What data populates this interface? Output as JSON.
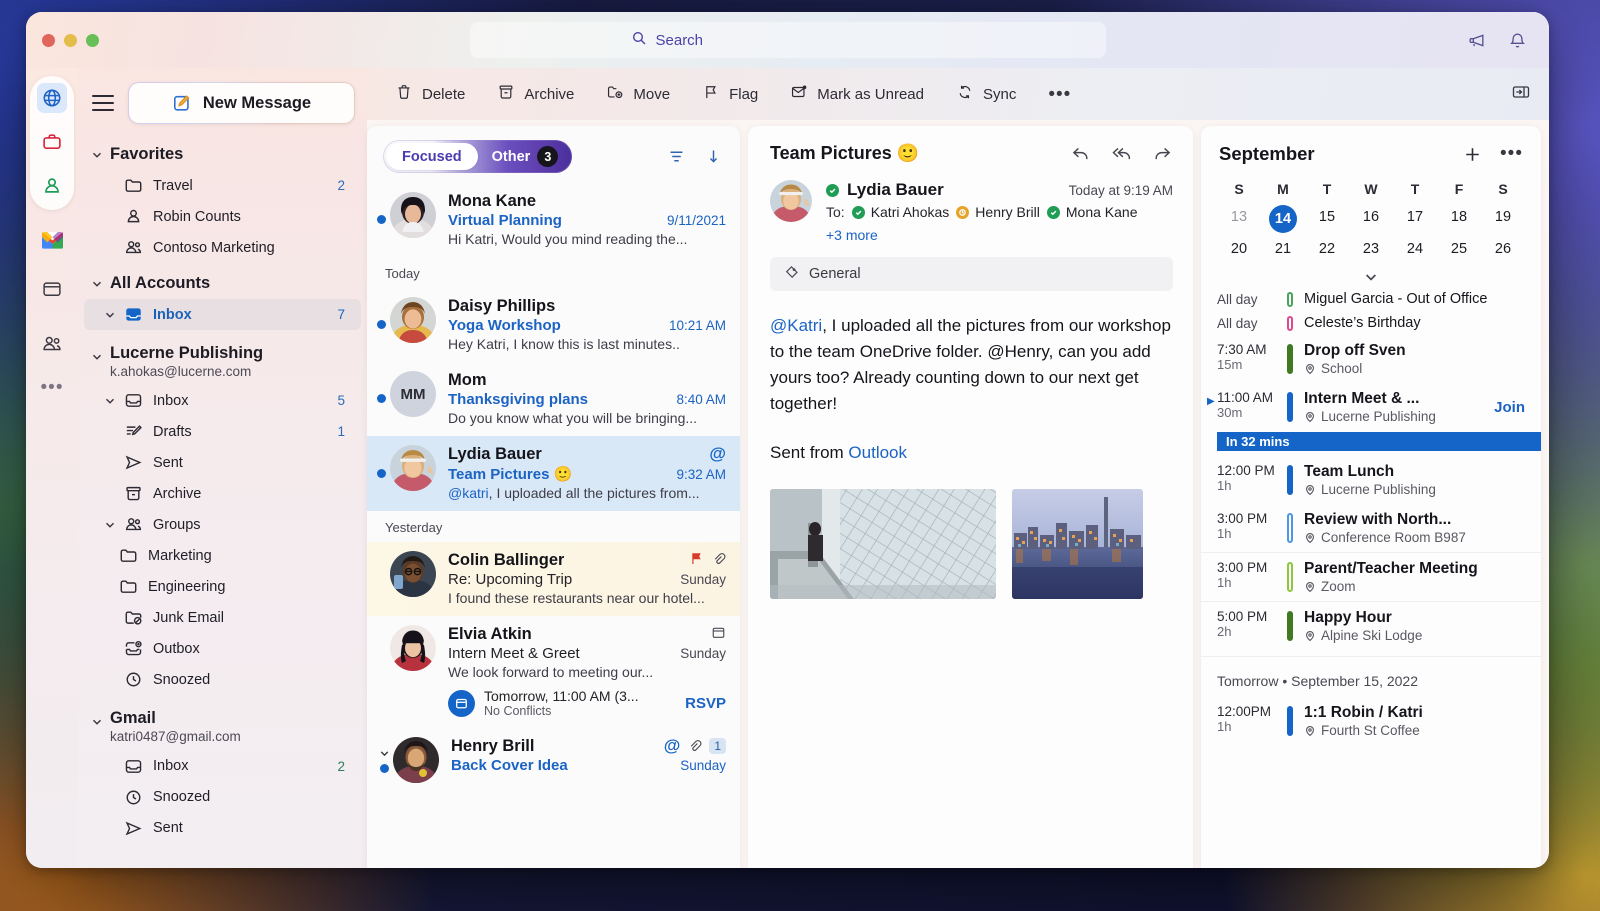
{
  "titlebar": {
    "search_placeholder": "Search",
    "icons": [
      "megaphone-icon",
      "bell-icon"
    ]
  },
  "rail": {
    "items": [
      {
        "name": "globe-icon",
        "selected": true
      },
      {
        "name": "briefcase-icon",
        "selected": false
      },
      {
        "name": "person-icon",
        "selected": false
      },
      {
        "name": "gmail-icon",
        "selected": false
      },
      {
        "name": "calendar-icon",
        "selected": false
      },
      {
        "name": "people-icon",
        "selected": false
      },
      {
        "name": "more-icon",
        "label": "•••"
      }
    ]
  },
  "sidebar": {
    "new_message": "New Message",
    "favorites": {
      "title": "Favorites",
      "items": [
        {
          "label": "Travel",
          "icon": "folder-icon",
          "count": "2"
        },
        {
          "label": "Robin Counts",
          "icon": "person-icon",
          "count": ""
        },
        {
          "label": "Contoso Marketing",
          "icon": "people-icon",
          "count": ""
        }
      ]
    },
    "all_accounts": {
      "title": "All Accounts",
      "items": [
        {
          "label": "Inbox",
          "icon": "inbox-icon",
          "count": "7",
          "active": true
        }
      ]
    },
    "accounts": [
      {
        "name": "Lucerne Publishing",
        "email": "k.ahokas@lucerne.com",
        "items": [
          {
            "label": "Inbox",
            "icon": "inbox-icon",
            "count": "5",
            "twisty": true,
            "indent": 1
          },
          {
            "label": "Drafts",
            "icon": "drafts-icon",
            "count": "1",
            "indent": 1
          },
          {
            "label": "Sent",
            "icon": "sent-icon",
            "count": "",
            "indent": 1
          },
          {
            "label": "Archive",
            "icon": "archive-icon",
            "count": "",
            "indent": 1
          },
          {
            "label": "Groups",
            "icon": "people-icon",
            "count": "",
            "twisty": true,
            "indent": 1
          },
          {
            "label": "Marketing",
            "icon": "folder-icon",
            "count": "",
            "indent": 2
          },
          {
            "label": "Engineering",
            "icon": "folder-icon",
            "count": "",
            "indent": 2
          },
          {
            "label": "Junk Email",
            "icon": "junk-icon",
            "count": "",
            "indent": 1
          },
          {
            "label": "Outbox",
            "icon": "outbox-icon",
            "count": "",
            "indent": 1
          },
          {
            "label": "Snoozed",
            "icon": "clock-icon",
            "count": "",
            "indent": 1
          }
        ]
      },
      {
        "name": "Gmail",
        "email": "katri0487@gmail.com",
        "items": [
          {
            "label": "Inbox",
            "icon": "inbox-icon",
            "count": "2",
            "indent": 1
          },
          {
            "label": "Snoozed",
            "icon": "clock-icon",
            "count": "",
            "indent": 1
          },
          {
            "label": "Sent",
            "icon": "sent-icon",
            "count": "",
            "indent": 1
          }
        ]
      }
    ]
  },
  "toolbar": {
    "items": [
      {
        "label": "Delete",
        "icon": "trash-icon"
      },
      {
        "label": "Archive",
        "icon": "archive-icon"
      },
      {
        "label": "Move",
        "icon": "move-icon"
      },
      {
        "label": "Flag",
        "icon": "flag-icon"
      },
      {
        "label": "Mark as Unread",
        "icon": "mail-unread-icon"
      },
      {
        "label": "Sync",
        "icon": "sync-icon"
      }
    ],
    "overflow": "•••",
    "pane_toggle": "pane-toggle-icon"
  },
  "message_list": {
    "pivot": {
      "focused": "Focused",
      "other": "Other",
      "other_count": "3"
    },
    "actions": [
      "filter-icon",
      "sort-icon"
    ],
    "groups": [
      {
        "label": "",
        "messages": [
          {
            "sender": "Mona Kane",
            "subject": "Virtual Planning",
            "preview": "Hi Katri, Would you mind reading the...",
            "time": "9/11/2021",
            "unread": true,
            "avatar_type": "photo",
            "avatar_style": "mona"
          }
        ]
      },
      {
        "label": "Today",
        "messages": [
          {
            "sender": "Daisy Phillips",
            "subject": "Yoga Workshop",
            "preview": "Hey Katri, I know this is last minutes..",
            "time": "10:21 AM",
            "unread": true,
            "avatar_type": "photo",
            "avatar_style": "daisy"
          },
          {
            "sender": "Mom",
            "subject": "Thanksgiving plans",
            "preview": "Do you know what you will be bringing...",
            "time": "8:40 AM",
            "unread": true,
            "avatar_type": "initials",
            "initials": "MM"
          },
          {
            "sender": "Lydia Bauer",
            "subject": "Team Pictures 🙂",
            "preview_mention": "@katri",
            "preview": ", I uploaded all the pictures from...",
            "time": "9:32 AM",
            "unread": true,
            "selected": true,
            "mention_flag": "@",
            "avatar_type": "photo",
            "avatar_style": "lydia"
          }
        ]
      },
      {
        "label": "Yesterday",
        "messages": [
          {
            "sender": "Colin Ballinger",
            "subject": "Re: Upcoming Trip",
            "subject_plain": true,
            "preview": "I found these restaurants near our hotel...",
            "time": "Sunday",
            "time_grey": true,
            "flagged": true,
            "has_flag_icon": true,
            "has_attach": true,
            "avatar_type": "photo",
            "avatar_style": "colin"
          },
          {
            "sender": "Elvia Atkin",
            "subject": "Intern Meet & Greet",
            "subject_plain": true,
            "preview": "We look forward to meeting our...",
            "time": "Sunday",
            "time_grey": true,
            "has_calendar_icon": true,
            "avatar_type": "photo",
            "avatar_style": "elvia",
            "rsvp": {
              "line1": "Tomorrow, 11:00 AM (3...",
              "line2": "No Conflicts",
              "button": "RSVP"
            }
          },
          {
            "sender": "Henry Brill",
            "subject": "Back Cover Idea",
            "time": "Sunday",
            "unread": true,
            "twisty": true,
            "mention_flag": "@",
            "has_attach": true,
            "count_badge": "1",
            "avatar_type": "photo",
            "avatar_style": "henry"
          }
        ]
      }
    ]
  },
  "reading_pane": {
    "title": "Team Pictures 🙂",
    "actions": [
      "reply-icon",
      "reply-all-icon",
      "forward-icon"
    ],
    "sender": "Lydia Bauer",
    "sender_presence": "available",
    "timestamp": "Today at 9:19 AM",
    "to_label": "To:",
    "recipients": [
      {
        "name": "Katri Ahokas",
        "presence": "available"
      },
      {
        "name": "Henry Brill",
        "presence": "away"
      },
      {
        "name": "Mona Kane",
        "presence": "available"
      }
    ],
    "more_recipients": "+3 more",
    "tag": "General",
    "body_mention": "@Katri",
    "body_text": ", I uploaded all the pictures from our workshop to the team OneDrive folder. @Henry, can you add yours too? Already counting down to our next get together!",
    "sent_from_label": "Sent from ",
    "sent_from_link": "Outlook",
    "attachments": [
      "glass-architecture-photo",
      "city-skyline-photo"
    ]
  },
  "calendar": {
    "month": "September",
    "add_icon": "plus-icon",
    "more_icon": "•••",
    "dow": [
      "S",
      "M",
      "T",
      "W",
      "T",
      "F",
      "S"
    ],
    "weeks": [
      [
        {
          "d": "13",
          "dim": true
        },
        {
          "d": "14",
          "selected": true
        },
        {
          "d": "15"
        },
        {
          "d": "16"
        },
        {
          "d": "17"
        },
        {
          "d": "18"
        },
        {
          "d": "19"
        }
      ],
      [
        {
          "d": "20"
        },
        {
          "d": "21"
        },
        {
          "d": "22"
        },
        {
          "d": "23"
        },
        {
          "d": "24"
        },
        {
          "d": "25"
        },
        {
          "d": "26"
        }
      ]
    ],
    "events": [
      {
        "time": "All day",
        "dur": "",
        "title": "Miguel Garcia - Out of Office",
        "loc": "",
        "color": "#4aa35a",
        "filled": false,
        "allday": true,
        "light": true
      },
      {
        "time": "All day",
        "dur": "",
        "title": "Celeste’s Birthday",
        "loc": "",
        "color": "#e0498f",
        "filled": false,
        "allday": true,
        "light": true
      },
      {
        "time": "7:30 AM",
        "dur": "15m",
        "title": "Drop off Sven",
        "loc": "School",
        "color": "#3f7a23",
        "filled": true
      },
      {
        "time": "11:00 AM",
        "dur": "30m",
        "title": "Intern Meet & ...",
        "loc": "Lucerne Publishing",
        "color": "#1565c9",
        "filled": true,
        "join": "Join",
        "caret": true
      },
      {
        "time": "12:00 PM",
        "dur": "1h",
        "title": "Team Lunch",
        "loc": "Lucerne Publishing",
        "color": "#1565c9",
        "filled": true
      },
      {
        "time": "3:00 PM",
        "dur": "1h",
        "title": "Review with North...",
        "loc": "Conference Room B987",
        "color": "#4f95e8",
        "filled": false
      },
      {
        "time": "3:00 PM",
        "dur": "1h",
        "title": "Parent/Teacher Meeting",
        "loc": "Zoom",
        "color": "#8ec63f",
        "filled": false
      },
      {
        "time": "5:00 PM",
        "dur": "2h",
        "title": "Happy Hour",
        "loc": "Alpine Ski Lodge",
        "color": "#3f7a23",
        "filled": true
      }
    ],
    "now_chip": "In 32 mins",
    "tomorrow_label": "Tomorrow • September 15, 2022",
    "tomorrow_events": [
      {
        "time": "12:00PM",
        "dur": "1h",
        "title": "1:1 Robin / Katri",
        "loc": "Fourth St Coffee",
        "color": "#1565c9",
        "filled": true
      }
    ]
  }
}
